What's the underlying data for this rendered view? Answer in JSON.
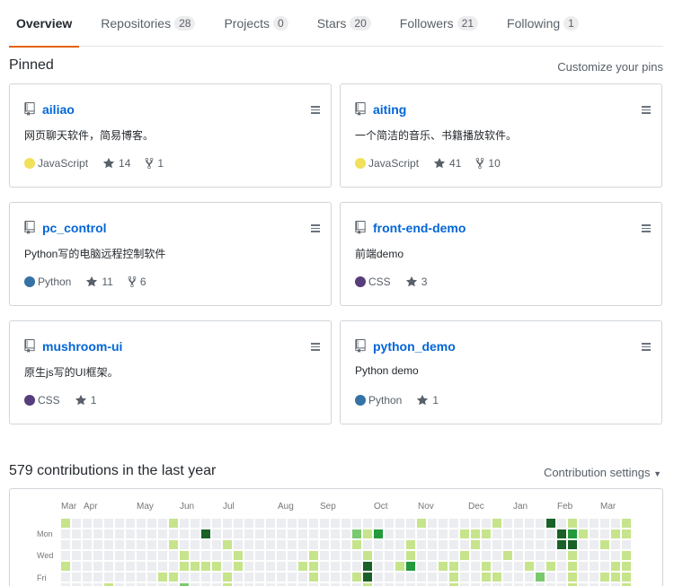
{
  "tabs": [
    {
      "label": "Overview",
      "count": null,
      "active": true
    },
    {
      "label": "Repositories",
      "count": "28",
      "active": false
    },
    {
      "label": "Projects",
      "count": "0",
      "active": false
    },
    {
      "label": "Stars",
      "count": "20",
      "active": false
    },
    {
      "label": "Followers",
      "count": "21",
      "active": false
    },
    {
      "label": "Following",
      "count": "1",
      "active": false
    }
  ],
  "pinned": {
    "title": "Pinned",
    "customize_label": "Customize your pins",
    "repos": [
      {
        "name": "ailiao",
        "description": "网页聊天软件，简易博客。",
        "language": "JavaScript",
        "language_color": "#f1e05a",
        "stars": "14",
        "forks": "1"
      },
      {
        "name": "aiting",
        "description": "一个简洁的音乐、书籍播放软件。",
        "language": "JavaScript",
        "language_color": "#f1e05a",
        "stars": "41",
        "forks": "10"
      },
      {
        "name": "pc_control",
        "description": "Python写的电脑远程控制软件",
        "language": "Python",
        "language_color": "#3572A5",
        "stars": "11",
        "forks": "6"
      },
      {
        "name": "front-end-demo",
        "description": "前端demo",
        "language": "CSS",
        "language_color": "#563d7c",
        "stars": "3",
        "forks": null
      },
      {
        "name": "mushroom-ui",
        "description": "原生js写的UI框架。",
        "language": "CSS",
        "language_color": "#563d7c",
        "stars": "1",
        "forks": null
      },
      {
        "name": "python_demo",
        "description": "Python demo",
        "language": "Python",
        "language_color": "#3572A5",
        "stars": "1",
        "forks": null
      }
    ]
  },
  "contributions": {
    "title": "579 contributions in the last year",
    "settings_label": "Contribution settings",
    "months": [
      "Mar",
      "Apr",
      "May",
      "Jun",
      "Jul",
      "Aug",
      "Sep",
      "Oct",
      "Nov",
      "Dec",
      "Jan",
      "Feb",
      "Mar"
    ],
    "day_labels": [
      "Mon",
      "Wed",
      "Fri"
    ],
    "level_colors": [
      "#ebedf0",
      "#c6e48b",
      "#7bc96f",
      "#239a3b",
      "#196127"
    ]
  },
  "colors": {
    "link": "#0366d6",
    "tab_underline": "#e36209"
  }
}
